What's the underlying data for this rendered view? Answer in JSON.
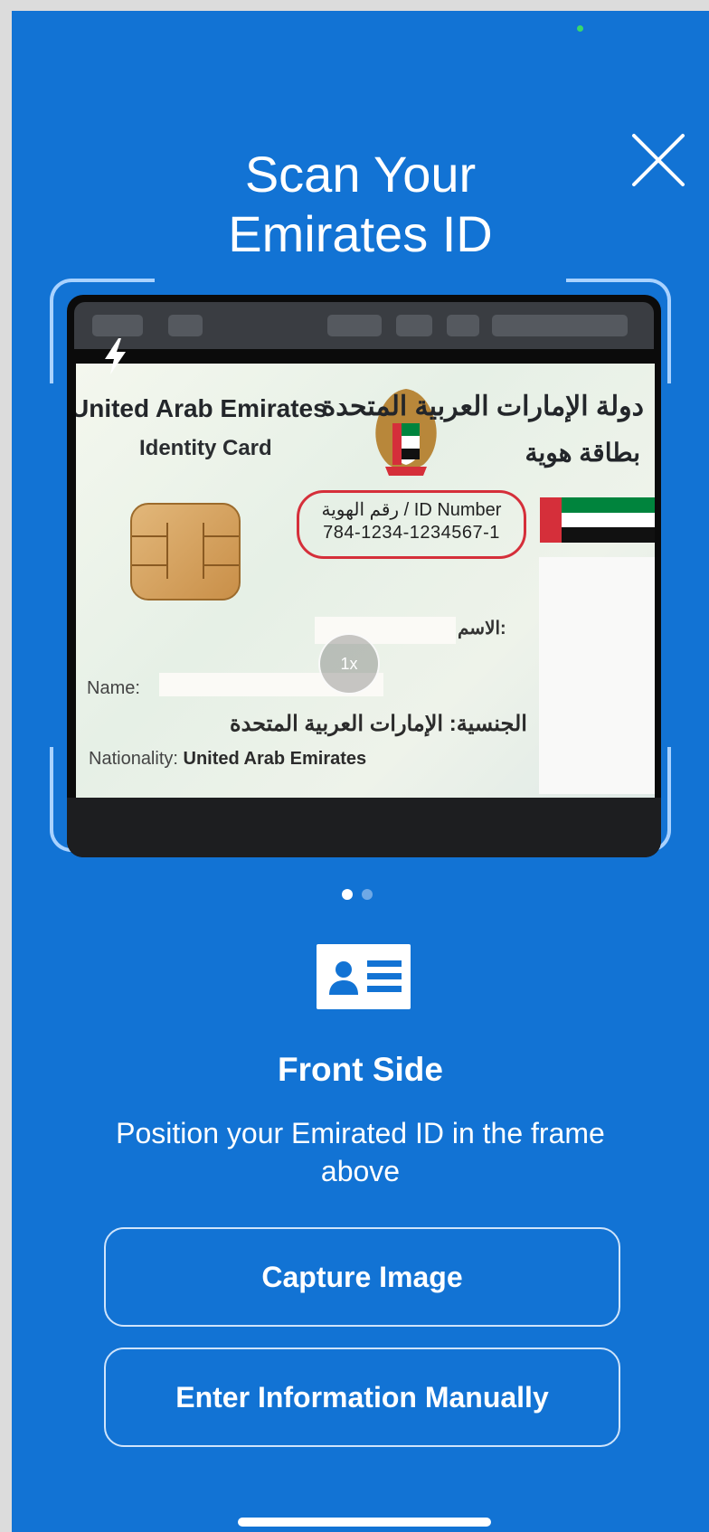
{
  "header": {
    "title_line1": "Scan Your",
    "title_line2": "Emirates ID",
    "close_icon": "close-icon"
  },
  "camera": {
    "flash_icon": "flash-icon",
    "zoom_label": "1x",
    "card": {
      "title_en": "United Arab Emirates",
      "subtitle_en": "Identity Card",
      "title_ar": "دولة الإمارات العربية المتحدة",
      "subtitle_ar": "بطاقة هوية",
      "id_label": "ID Number / رقم الهوية",
      "id_number": "784-1234-1234567-1",
      "name_label_ar": "الاسم:",
      "name_label_en": "Name:",
      "nationality_ar": "الجنسية:  الإمارات العربية المتحدة",
      "nationality_label_en": "Nationality:",
      "nationality_value_en": "United Arab Emirates"
    }
  },
  "pager": {
    "pages": 2,
    "active_index": 0
  },
  "side": {
    "icon": "id-card-icon",
    "title": "Front Side",
    "instruction": "Position your Emirated ID in the frame above"
  },
  "actions": {
    "capture_label": "Capture Image",
    "manual_label": "Enter Information Manually"
  },
  "colors": {
    "background": "#1273d4",
    "frame": "#a9d2ff",
    "highlight": "#d52f3a"
  }
}
